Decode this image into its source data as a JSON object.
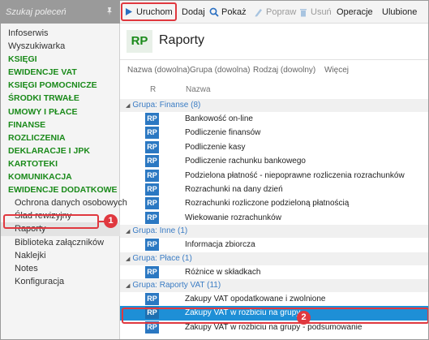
{
  "search": {
    "placeholder": "Szukaj poleceń"
  },
  "sidebar": {
    "items": [
      {
        "label": "Infoserwis",
        "kind": "plain"
      },
      {
        "label": "Wyszukiwarka",
        "kind": "plain"
      },
      {
        "label": "KSIĘGI",
        "kind": "section"
      },
      {
        "label": "EWIDENCJE VAT",
        "kind": "section"
      },
      {
        "label": "KSIĘGI POMOCNICZE",
        "kind": "section"
      },
      {
        "label": "ŚRODKI TRWAŁE",
        "kind": "section"
      },
      {
        "label": "UMOWY I PŁACE",
        "kind": "section"
      },
      {
        "label": "FINANSE",
        "kind": "section"
      },
      {
        "label": "ROZLICZENIA",
        "kind": "section"
      },
      {
        "label": "DEKLARACJE I JPK",
        "kind": "section"
      },
      {
        "label": "KARTOTEKI",
        "kind": "section"
      },
      {
        "label": "KOMUNIKACJA",
        "kind": "section"
      },
      {
        "label": "EWIDENCJE DODATKOWE",
        "kind": "section"
      },
      {
        "label": "Ochrona danych osobowych",
        "kind": "sub"
      },
      {
        "label": "Ślad rewizyjny",
        "kind": "sub"
      },
      {
        "label": "Raporty",
        "kind": "sub",
        "active": true
      },
      {
        "label": "Biblioteka załączników",
        "kind": "sub"
      },
      {
        "label": "Naklejki",
        "kind": "sub"
      },
      {
        "label": "Notes",
        "kind": "sub"
      },
      {
        "label": "Konfiguracja",
        "kind": "sub"
      }
    ]
  },
  "toolbar": {
    "run_label": "Uruchom",
    "add_label": "Dodaj",
    "show_label": "Pokaż",
    "fix_label": "Popraw",
    "delete_label": "Usuń",
    "operations_label": "Operacje",
    "favorites_label": "Ulubione"
  },
  "header": {
    "badge": "RP",
    "title": "Raporty"
  },
  "filters": {
    "name": "Nazwa (dowolna)",
    "group": "Grupa (dowolna)",
    "type": "Rodzaj (dowolny)",
    "more": "Więcej"
  },
  "columns": {
    "r": "R",
    "name": "Nazwa"
  },
  "groups": [
    {
      "prefix": "Grupa:",
      "name": "Finanse",
      "count": "(8)",
      "rows": [
        {
          "badge": "RP",
          "label": "Bankowość on-line"
        },
        {
          "badge": "RP",
          "label": "Podliczenie finansów"
        },
        {
          "badge": "RP",
          "label": "Podliczenie kasy"
        },
        {
          "badge": "RP",
          "label": "Podliczenie rachunku bankowego"
        },
        {
          "badge": "RP",
          "label": "Podzielona płatność - niepoprawne rozliczenia rozrachunków"
        },
        {
          "badge": "RP",
          "label": "Rozrachunki na dany dzień"
        },
        {
          "badge": "RP",
          "label": "Rozrachunki rozliczone podzieloną płatnością"
        },
        {
          "badge": "RP",
          "label": "Wiekowanie rozrachunków"
        }
      ]
    },
    {
      "prefix": "Grupa:",
      "name": "Inne",
      "count": "(1)",
      "rows": [
        {
          "badge": "RP",
          "label": "Informacja zbiorcza"
        }
      ]
    },
    {
      "prefix": "Grupa:",
      "name": "Płace",
      "count": "(1)",
      "rows": [
        {
          "badge": "RP",
          "label": "Różnice w składkach"
        }
      ]
    },
    {
      "prefix": "Grupa:",
      "name": "Raporty VAT",
      "count": "(11)",
      "rows": [
        {
          "badge": "RP",
          "label": "Zakupy VAT opodatkowane i zwolnione"
        },
        {
          "badge": "RP",
          "label": "Zakupy VAT w rozbiciu na grupy",
          "selected": true
        },
        {
          "badge": "RP",
          "label": "Zakupy VAT w rozbiciu na grupy - podsumowanie"
        }
      ]
    }
  ],
  "callouts": {
    "one": "1",
    "two": "2"
  },
  "colors": {
    "accent_green": "#1a8a1a",
    "selection_blue": "#1e8fd6",
    "callout_red": "#e0383f",
    "group_blue": "#3a7cc4"
  }
}
